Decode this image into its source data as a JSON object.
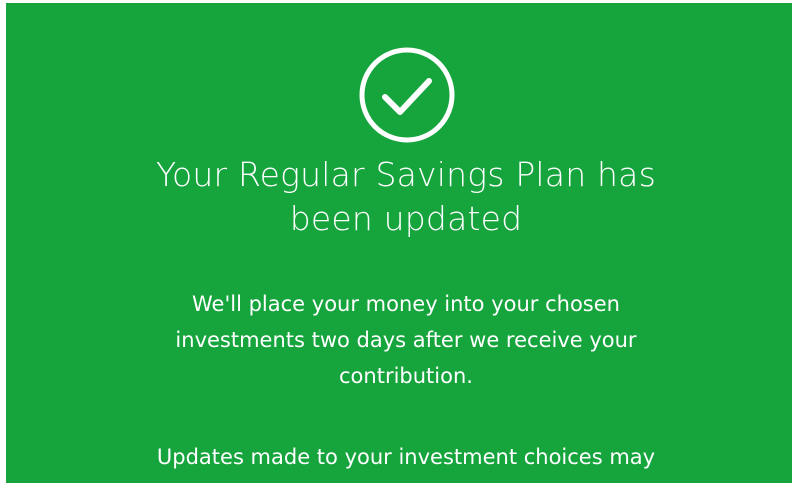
{
  "confirmation": {
    "icon": "check-circle-icon",
    "accent_color": "#16a43d",
    "title_lines": [
      "Your Regular Savings Plan has",
      "been updated"
    ],
    "paragraph_1_lines": [
      "We'll place your money into your chosen",
      "investments two days after we receive your",
      "contribution."
    ],
    "paragraph_2_lines": [
      "Updates made to your investment choices may"
    ]
  }
}
